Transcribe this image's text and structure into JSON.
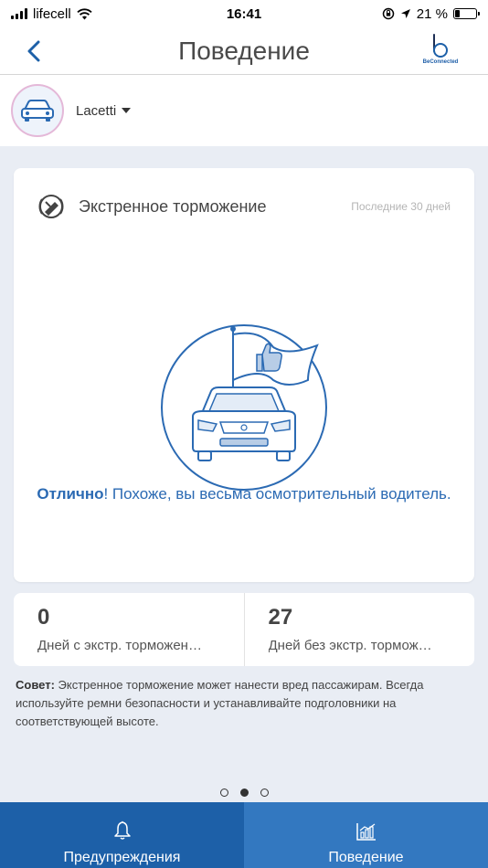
{
  "status_bar": {
    "carrier": "lifecell",
    "time": "16:41",
    "battery": "21 %",
    "battery_level": 0.21
  },
  "header": {
    "title": "Поведение",
    "brand": "BeConnected"
  },
  "vehicle": {
    "name": "Lacetti"
  },
  "card": {
    "title": "Экстренное торможение",
    "period": "Последние 30 дней",
    "message_bold": "Отлично",
    "message_rest": "! Похоже, вы весьма осмотрительный водитель."
  },
  "stats": [
    {
      "value": "0",
      "label": "Дней с экстр. торможен…"
    },
    {
      "value": "27",
      "label": "Дней без экстр. тормож…"
    }
  ],
  "tip": {
    "label": "Совет:",
    "text": " Экстренное торможение может нанести вред пассажирам. Всегда используйте ремни безопасности и устанавливайте подголовники на соответствующей высоте."
  },
  "pager": {
    "pages": 3,
    "active": 2
  },
  "tabs": [
    {
      "label": "Предупреждения",
      "icon": "bell-icon",
      "active": false
    },
    {
      "label": "Поведение",
      "icon": "chart-icon",
      "active": true
    }
  ],
  "colors": {
    "accent": "#2b6ab3",
    "tab_bar": "#1d60a8",
    "tab_active": "#3378c0",
    "background": "#e9edf4"
  }
}
